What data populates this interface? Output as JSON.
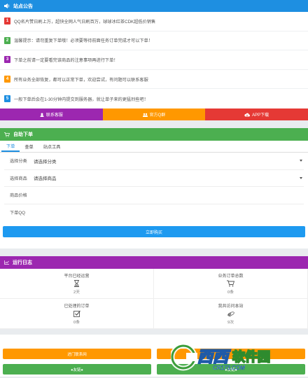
{
  "announcement": {
    "title": "站点公告",
    "items": [
      {
        "num": "1",
        "color": "#e53935",
        "text": "QQ名片赞日刷上万，超快全网人气日刷百万，球球冰红茶CDK超低价销售"
      },
      {
        "num": "2",
        "color": "#4caf50",
        "text": "温馨提示：请勿重复下单哦！必须要等待前面任务订单完成才可以下单！"
      },
      {
        "num": "3",
        "color": "#9c27b0",
        "text": "下单之前请一定要看完该商品的注意事项再进行下单！"
      },
      {
        "num": "4",
        "color": "#ff9800",
        "text": "所有业务全部恢复，都可以正常下单，欢迎尝试，有问题可以联系客服"
      },
      {
        "num": "5",
        "color": "#1e8fe1",
        "text": "一般下单后会在1-30分钟内提交到服务器，就让单子来的更猛烈些吧！"
      }
    ]
  },
  "links": [
    {
      "label": "联系客服",
      "icon": "person-icon",
      "color": "#9c27b0"
    },
    {
      "label": "官方Q群",
      "icon": "group-icon",
      "color": "#ff9800"
    },
    {
      "label": "APP下载",
      "icon": "cloud-download-icon",
      "color": "#e53935"
    }
  ],
  "order": {
    "title": "自助下单",
    "tabs": [
      "下单",
      "查单",
      "站点工具"
    ],
    "fields": [
      {
        "label": "选择分类",
        "value": "请选择分类",
        "dropdown": true
      },
      {
        "label": "选择商品",
        "value": "请选择商品",
        "dropdown": true
      },
      {
        "label": "商品价格",
        "value": "",
        "dropdown": false
      },
      {
        "label": "下单QQ",
        "value": "",
        "dropdown": false
      }
    ],
    "submit": "立即购买"
  },
  "log": {
    "title": "运行日志",
    "stats": [
      {
        "label": "平台已经运营",
        "value": "2天",
        "icon": "hourglass-icon"
      },
      {
        "label": "业务订单总数",
        "value": "0条",
        "icon": "cart-icon"
      },
      {
        "label": "已处理的订单",
        "value": "0条",
        "icon": "checkbox-icon"
      },
      {
        "label": "我共访问本站",
        "value": "9次",
        "icon": "ie-icon"
      }
    ]
  },
  "bottom": {
    "buttons": [
      {
        "label": "进门联系网",
        "color": "#ff9800"
      },
      {
        "label": "●友链●",
        "color": "#4caf50"
      },
      {
        "label": "●友链●",
        "color": "#4caf50"
      }
    ]
  },
  "watermark": {
    "text1": "西西",
    "text2": "软件园",
    "text3": "CR173.COM"
  }
}
